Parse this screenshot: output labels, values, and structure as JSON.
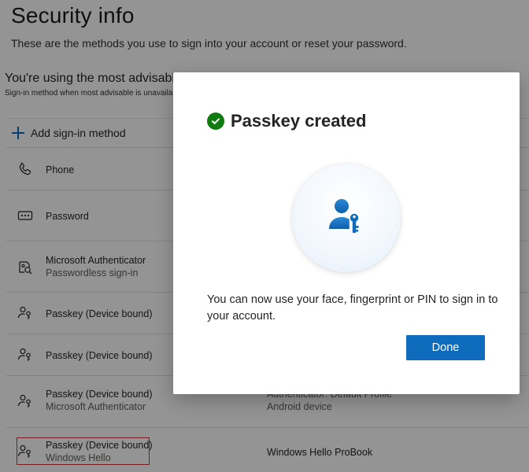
{
  "page": {
    "title": "Security info",
    "subtitle": "These are the methods you use to sign into your account or reset your password.",
    "advisable_title": "You're using the most advisable",
    "advisable_sub": "Sign-in method when most advisable is unavaila"
  },
  "add_method": {
    "label": "Add sign-in method",
    "icon": "plus-icon"
  },
  "methods": [
    {
      "name": "Phone",
      "detail": "",
      "icon": "phone-icon"
    },
    {
      "name": "Password",
      "detail": "",
      "icon": "password-icon"
    },
    {
      "name": "Microsoft Authenticator",
      "detail": "Passwordless sign-in",
      "icon": "authenticator-icon"
    },
    {
      "name": "Passkey (Device bound)",
      "detail": "",
      "icon": "passkey-icon"
    },
    {
      "name": "Passkey (Device bound)",
      "detail": "",
      "icon": "passkey-icon"
    },
    {
      "name": "Passkey (Device bound)",
      "detail": "Microsoft Authenticator",
      "icon": "passkey-icon",
      "extra_name": "Authenticator: Default Profile",
      "extra_detail": "Android device"
    },
    {
      "name": "Passkey (Device bound)",
      "detail": "Windows Hello",
      "icon": "passkey-icon",
      "extra_name": "Windows Hello ProBook"
    }
  ],
  "dialog": {
    "title": "Passkey created",
    "message": "You can now use your face, fingerprint or PIN to sign in to your account.",
    "done_label": "Done",
    "icons": {
      "status": "check-circle-icon",
      "hero": "passkey-user-key-icon"
    }
  },
  "colors": {
    "accent": "#0f6cbd",
    "success": "#107c10",
    "highlight": "#d13438",
    "overlay": "rgba(0,0,0,0.42)"
  }
}
